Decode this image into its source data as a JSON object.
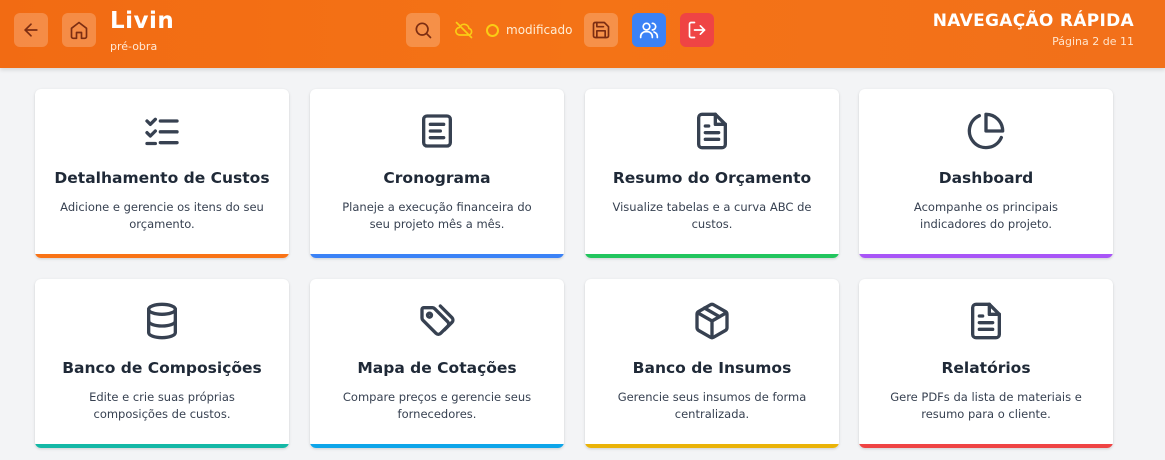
{
  "header": {
    "title": "Livin",
    "subtitle": "pré-obra",
    "status_text": "modificado",
    "nav_title": "NAVEGAÇÃO RÁPIDA",
    "page_indicator": "Página 2 de 11",
    "icons": [
      "arrow-left-icon",
      "home-icon",
      "search-icon",
      "cloud-off-icon",
      "save-icon",
      "users-icon",
      "logout-icon"
    ],
    "colors": {
      "bar": "#f47316",
      "users_button": "#3b82f6",
      "logout_button": "#ef4444",
      "status_dot": "#facc15"
    }
  },
  "cards": [
    {
      "title": "Detalhamento de Custos",
      "description": "Adicione e gerencie os itens do seu orçamento.",
      "icon": "list-check-icon",
      "accent": "#f97316"
    },
    {
      "title": "Cronograma",
      "description": "Planeje a execução financeira do seu projeto mês a mês.",
      "icon": "text-box-icon",
      "accent": "#3b82f6"
    },
    {
      "title": "Resumo do Orçamento",
      "description": "Visualize tabelas e a curva ABC de custos.",
      "icon": "document-icon",
      "accent": "#22c55e"
    },
    {
      "title": "Dashboard",
      "description": "Acompanhe os principais indicadores do projeto.",
      "icon": "pie-chart-icon",
      "accent": "#a855f7"
    },
    {
      "title": "Banco de Composições",
      "description": "Edite e crie suas próprias composições de custos.",
      "icon": "database-icon",
      "accent": "#14b8a6"
    },
    {
      "title": "Mapa de Cotações",
      "description": "Compare preços e gerencie seus fornecedores.",
      "icon": "tags-icon",
      "accent": "#0ea5e9"
    },
    {
      "title": "Banco de Insumos",
      "description": "Gerencie seus insumos de forma centralizada.",
      "icon": "package-icon",
      "accent": "#eab308"
    },
    {
      "title": "Relatórios",
      "description": "Gere PDFs da lista de materiais e resumo para o cliente.",
      "icon": "report-icon",
      "accent": "#ef4444"
    }
  ]
}
